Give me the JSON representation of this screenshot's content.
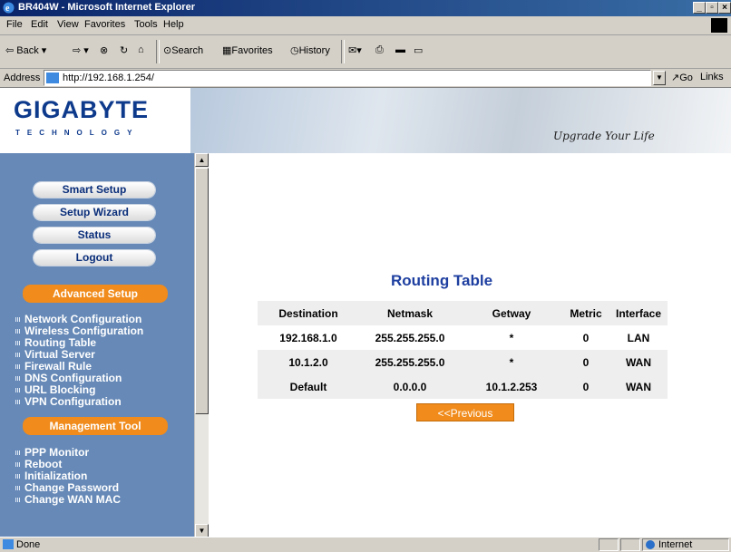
{
  "window": {
    "title": "BR404W - Microsoft Internet Explorer"
  },
  "menu": [
    "File",
    "Edit",
    "View",
    "Favorites",
    "Tools",
    "Help"
  ],
  "toolbar": {
    "back": "Back",
    "search": "Search",
    "favorites": "Favorites",
    "history": "History"
  },
  "address": {
    "label": "Address",
    "url": "http://192.168.1.254/",
    "go": "Go",
    "links": "Links"
  },
  "brand": {
    "name": "GIGABYTE",
    "sub": "TECHNOLOGY",
    "tagline": "Upgrade Your Life"
  },
  "sidebar": {
    "buttons": [
      "Smart Setup",
      "Setup Wizard",
      "Status",
      "Logout"
    ],
    "advanced_header": "Advanced Setup",
    "advanced_links": [
      "Network Configuration",
      "Wireless Configuration",
      "Routing Table",
      "Virtual Server",
      "Firewall Rule",
      "DNS Configuration",
      "URL Blocking",
      "VPN Configuration"
    ],
    "management_header": "Management Tool",
    "management_links": [
      "PPP Monitor",
      "Reboot",
      "Initialization",
      "Change Password",
      "Change WAN MAC"
    ]
  },
  "routing": {
    "title": "Routing Table",
    "headers": [
      "Destination",
      "Netmask",
      "Getway",
      "Metric",
      "Interface"
    ],
    "rows": [
      [
        "192.168.1.0",
        "255.255.255.0",
        "*",
        "0",
        "LAN"
      ],
      [
        "10.1.2.0",
        "255.255.255.0",
        "*",
        "0",
        "WAN"
      ],
      [
        "Default",
        "0.0.0.0",
        "10.1.2.253",
        "0",
        "WAN"
      ]
    ],
    "previous_label": "<<Previous"
  },
  "status": {
    "text": "Done",
    "zone": "Internet"
  },
  "colors": {
    "sidebar": "#6689b7",
    "accent_orange": "#f08b1c",
    "title_blue": "#1e3fa0"
  }
}
